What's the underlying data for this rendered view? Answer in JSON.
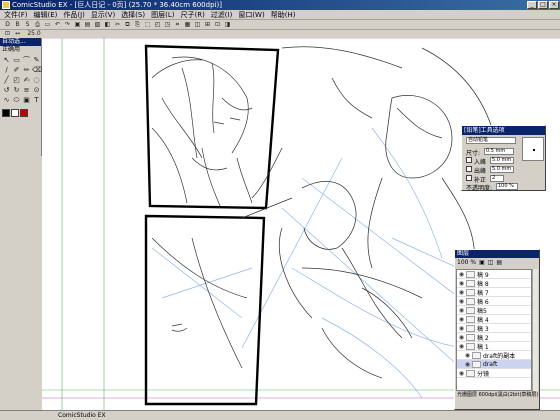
{
  "window": {
    "title": "ComicStudio EX - [巨人日记 - 0页] (25.70 * 36.40cm 600dpi)]",
    "min": "_",
    "max": "□",
    "close": "×"
  },
  "menu": [
    "文件(F)",
    "编辑(E)",
    "作品(J)",
    "显示(V)",
    "选择(S)",
    "图层(L)",
    "尺子(R)",
    "过滤(I)",
    "窗口(W)",
    "帮助(H)"
  ],
  "toolbar": [
    "D",
    "B",
    "S",
    "⎙",
    "▭",
    "↶",
    "↷",
    "▣",
    "▤",
    "▧",
    "◧",
    "✂",
    "⧉",
    "⎘",
    "⬚",
    "◰",
    "◳",
    "⌗",
    "▦",
    "◫",
    "⊞",
    "⊡",
    "◨"
  ],
  "toolbar2": [
    "⊡",
    "↔",
    "25.0",
    "",
    "",
    "",
    "",
    "",
    ""
  ],
  "tools": {
    "title": "自动选...",
    "subtitle": "正确用",
    "items": [
      "↖",
      "▭",
      "⌒",
      "✎",
      "∕",
      "✐",
      "✏",
      "⌫",
      "╱",
      "◰",
      "✍",
      "◌",
      "↺",
      "↻",
      "≡",
      "⊙",
      "∿",
      "⬭",
      "▣",
      "T"
    ],
    "colors": [
      "#000000",
      "#ffffff",
      "#c00000"
    ]
  },
  "status": {
    "left": "ComicStudio EX"
  },
  "pencil_panel": {
    "title": "[铅笔]工具选项",
    "preset": "自动铅笔",
    "size_label": "尺寸:",
    "size_value": "0.5 mm",
    "in_label": "入峰",
    "in_value": "5.0 mm",
    "out_label": "出峰",
    "out_value": "5.0 mm",
    "correct_label": "补正",
    "correct_value": "2",
    "opacity_label": "不透明度:",
    "opacity_value": "100 %"
  },
  "layer_panel": {
    "title": "图层",
    "opacity": "100 %",
    "layers": [
      {
        "name": "稿 9",
        "active": false,
        "sub": false
      },
      {
        "name": "稿 8",
        "active": false,
        "sub": false
      },
      {
        "name": "稿 7",
        "active": false,
        "sub": false
      },
      {
        "name": "稿 6",
        "active": false,
        "sub": false
      },
      {
        "name": "稿5",
        "active": false,
        "sub": false
      },
      {
        "name": "稿 4",
        "active": false,
        "sub": false
      },
      {
        "name": "稿 3",
        "active": false,
        "sub": false
      },
      {
        "name": "稿 2",
        "active": false,
        "sub": false
      },
      {
        "name": "稿 1",
        "active": false,
        "sub": false
      },
      {
        "name": "draft的副本",
        "active": false,
        "sub": true
      },
      {
        "name": "draft",
        "active": true,
        "sub": true
      },
      {
        "name": "分镜",
        "active": false,
        "sub": false
      }
    ],
    "footer": "光栅图层 600dpi(黑白(2bit)草稿层)"
  }
}
